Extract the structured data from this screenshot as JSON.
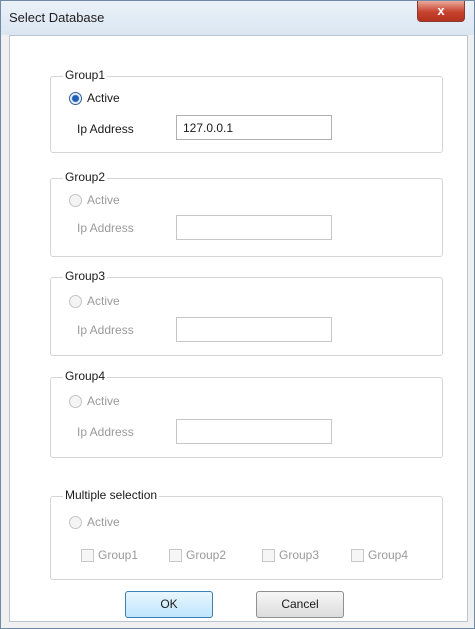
{
  "window": {
    "title": "Select Database",
    "close_glyph": "x"
  },
  "groups": [
    {
      "legend": "Group1",
      "radio_label": "Active",
      "checked": true,
      "field_label": "Ip Address",
      "ip_value": "127.0.0.1",
      "enabled": true
    },
    {
      "legend": "Group2",
      "radio_label": "Active",
      "checked": false,
      "field_label": "Ip Address",
      "ip_value": "",
      "enabled": false
    },
    {
      "legend": "Group3",
      "radio_label": "Active",
      "checked": false,
      "field_label": "Ip Address",
      "ip_value": "",
      "enabled": false
    },
    {
      "legend": "Group4",
      "radio_label": "Active",
      "checked": false,
      "field_label": "Ip Address",
      "ip_value": "",
      "enabled": false
    }
  ],
  "multiple": {
    "legend": "Multiple selection",
    "radio_label": "Active",
    "checkboxes": [
      "Group1",
      "Group2",
      "Group3",
      "Group4"
    ]
  },
  "buttons": {
    "ok": "OK",
    "cancel": "Cancel"
  },
  "colors": {
    "accent": "#1f5fb4",
    "disabled_text": "#9a9a9a",
    "close_red": "#c7422e"
  }
}
